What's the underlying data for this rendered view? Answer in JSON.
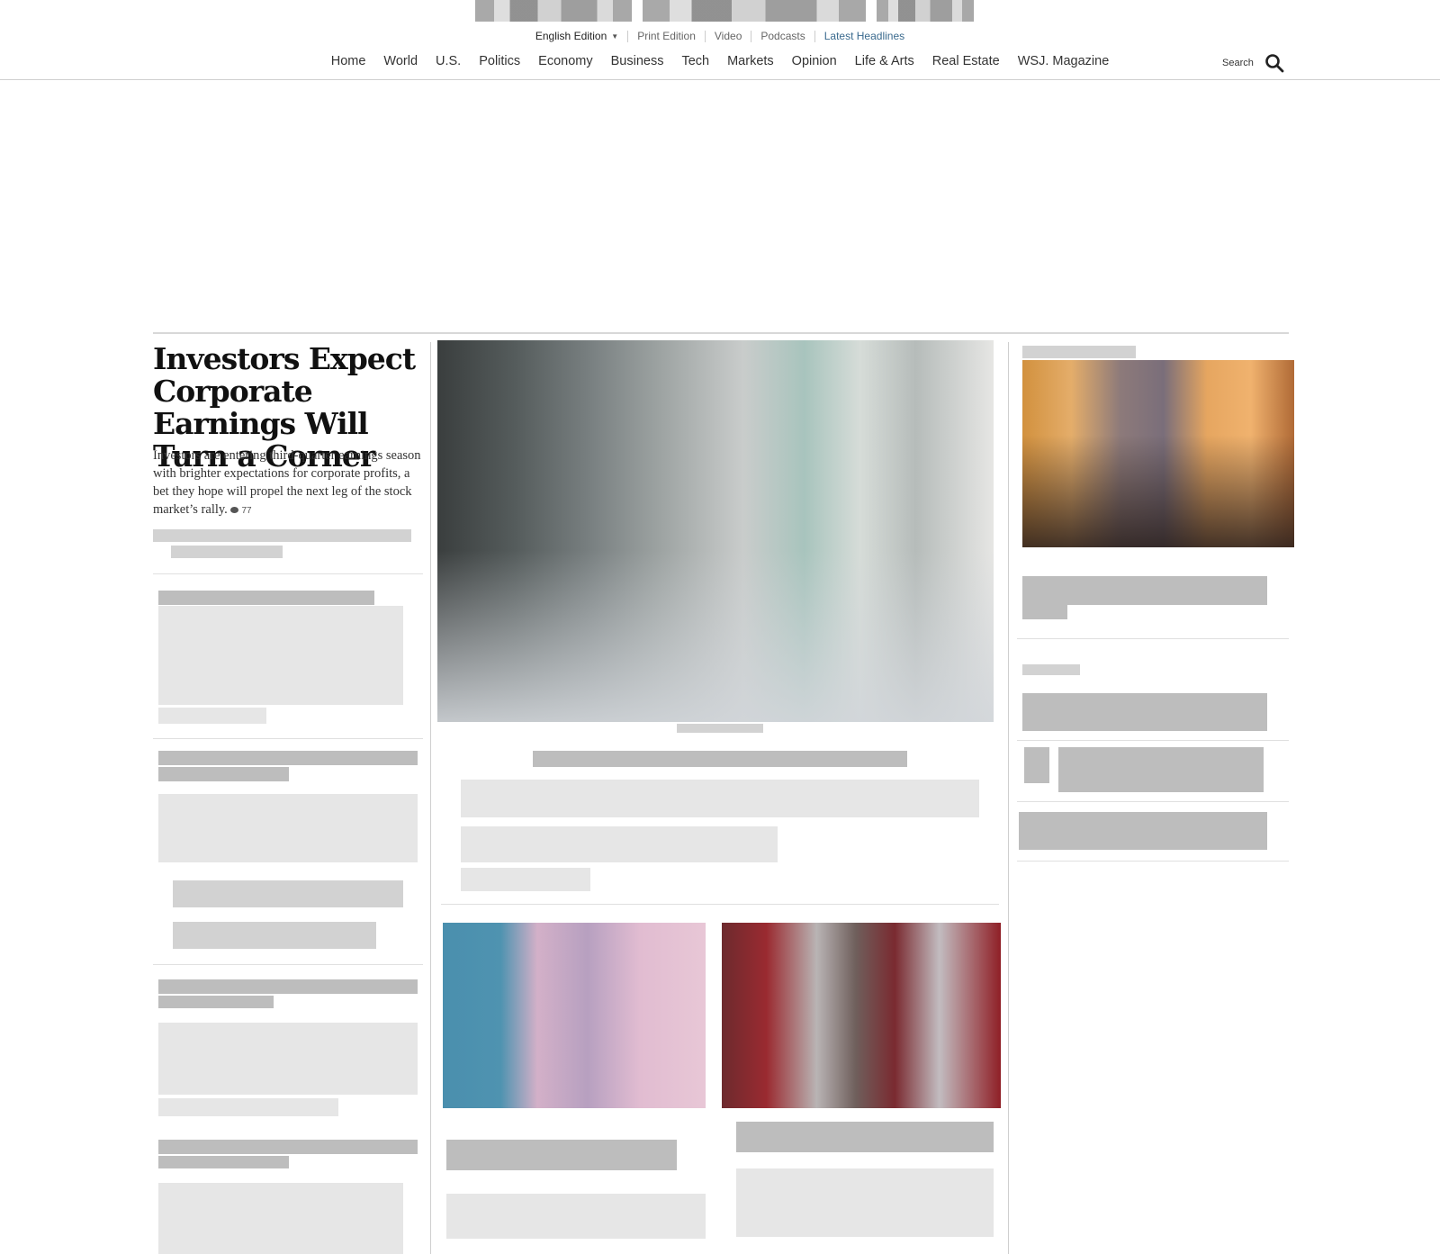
{
  "edition_bar": {
    "edition": "English Edition",
    "links": [
      "Print Edition",
      "Video",
      "Podcasts"
    ],
    "latest": "Latest Headlines"
  },
  "nav": {
    "items": [
      "Home",
      "World",
      "U.S.",
      "Politics",
      "Economy",
      "Business",
      "Tech",
      "Markets",
      "Opinion",
      "Life & Arts",
      "Real Estate",
      "WSJ. Magazine"
    ],
    "search_label": "Search"
  },
  "lead_story": {
    "headline": "Investors Expect Corporate Earnings Will Turn a Corner",
    "summary": "Investors are entering third-quarter earnings season with brighter expectations for corporate profits, a bet they hope will propel the next leg of the stock market’s rally.",
    "comment_count": "77"
  },
  "icons": {
    "search": "search-icon",
    "edition_caret": "caret-down-icon",
    "comment": "comment-bubble-icon"
  },
  "colors": {
    "latest_link": "#3a6a8e",
    "rules": "#cfcfcf"
  }
}
